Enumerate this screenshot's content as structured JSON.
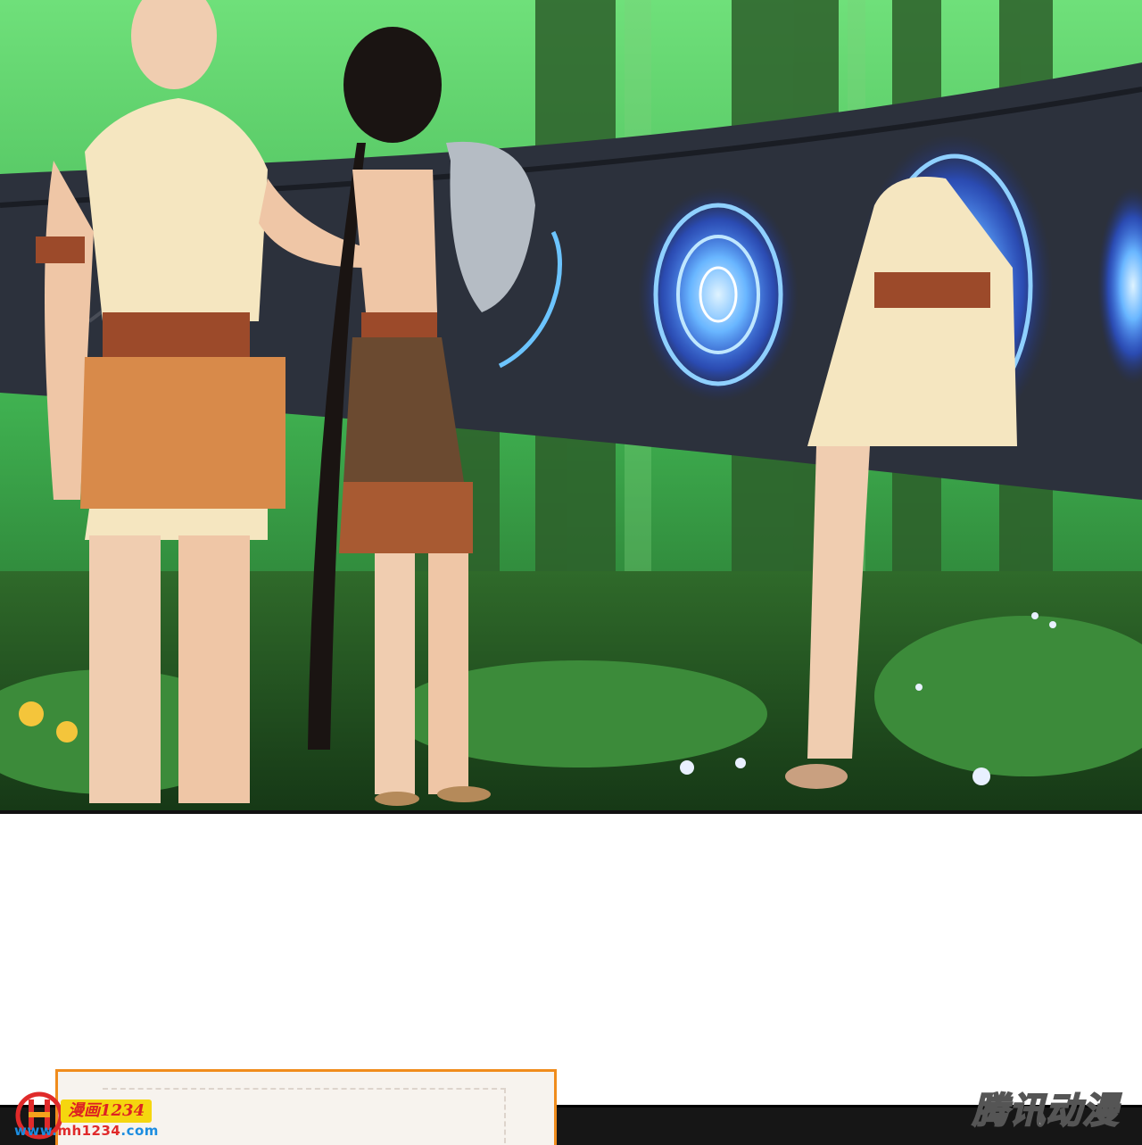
{
  "watermark": {
    "site_tag": "漫画1234",
    "site_url_prefix": "www.",
    "site_url_domain": "mh1234",
    "site_url_suffix": ".com",
    "publisher": "腾讯动漫"
  },
  "colors": {
    "forest_dark": "#1f4a1c",
    "forest_light": "#4ec25a",
    "scroll_dark": "#2a2f3a",
    "portal_blue": "#3a7cff",
    "tunic": "#f5e6c0",
    "belt": "#9c4a2a",
    "skirt": "#d88a4a",
    "hair": "#1a1412",
    "frame_orange": "#f08c1c"
  }
}
